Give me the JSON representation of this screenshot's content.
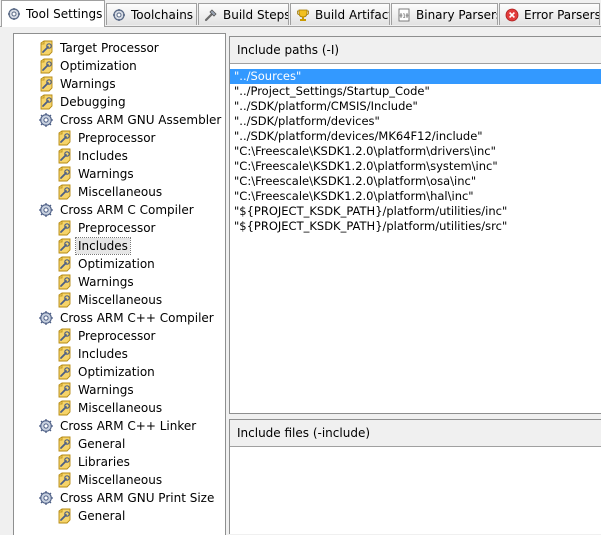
{
  "tabs": [
    {
      "label": "Tool Settings",
      "icon": "tool-settings-icon"
    },
    {
      "label": "Toolchains",
      "icon": "toolchains-icon"
    },
    {
      "label": "Build Steps",
      "icon": "build-steps-icon"
    },
    {
      "label": "Build Artifact",
      "icon": "build-artifact-icon"
    },
    {
      "label": "Binary Parsers",
      "icon": "binary-parsers-icon"
    },
    {
      "label": "Error Parsers",
      "icon": "error-parsers-icon"
    }
  ],
  "tree": {
    "items": [
      {
        "label": "Target Processor",
        "icon": "wrench-page-icon"
      },
      {
        "label": "Optimization",
        "icon": "wrench-page-icon"
      },
      {
        "label": "Warnings",
        "icon": "wrench-page-icon"
      },
      {
        "label": "Debugging",
        "icon": "wrench-page-icon"
      },
      {
        "label": "Cross ARM GNU Assembler",
        "icon": "tool-gear-icon"
      },
      {
        "label": "Preprocessor",
        "icon": "wrench-page-icon"
      },
      {
        "label": "Includes",
        "icon": "wrench-page-icon"
      },
      {
        "label": "Warnings",
        "icon": "wrench-page-icon"
      },
      {
        "label": "Miscellaneous",
        "icon": "wrench-page-icon"
      },
      {
        "label": "Cross ARM C Compiler",
        "icon": "tool-gear-icon"
      },
      {
        "label": "Preprocessor",
        "icon": "wrench-page-icon"
      },
      {
        "label": "Includes",
        "icon": "wrench-page-icon"
      },
      {
        "label": "Optimization",
        "icon": "wrench-page-icon"
      },
      {
        "label": "Warnings",
        "icon": "wrench-page-icon"
      },
      {
        "label": "Miscellaneous",
        "icon": "wrench-page-icon"
      },
      {
        "label": "Cross ARM C++ Compiler",
        "icon": "tool-gear-icon"
      },
      {
        "label": "Preprocessor",
        "icon": "wrench-page-icon"
      },
      {
        "label": "Includes",
        "icon": "wrench-page-icon"
      },
      {
        "label": "Optimization",
        "icon": "wrench-page-icon"
      },
      {
        "label": "Warnings",
        "icon": "wrench-page-icon"
      },
      {
        "label": "Miscellaneous",
        "icon": "wrench-page-icon"
      },
      {
        "label": "Cross ARM C++ Linker",
        "icon": "tool-gear-icon"
      },
      {
        "label": "General",
        "icon": "wrench-page-icon"
      },
      {
        "label": "Libraries",
        "icon": "wrench-page-icon"
      },
      {
        "label": "Miscellaneous",
        "icon": "wrench-page-icon"
      },
      {
        "label": "Cross ARM GNU Print Size",
        "icon": "tool-gear-icon"
      },
      {
        "label": "General",
        "icon": "wrench-page-icon"
      }
    ]
  },
  "include_paths": {
    "header": "Include paths (-I)",
    "items": [
      "\"../Sources\"",
      "\"../Project_Settings/Startup_Code\"",
      "\"../SDK/platform/CMSIS/Include\"",
      "\"../SDK/platform/devices\"",
      "\"../SDK/platform/devices/MK64F12/include\"",
      "\"C:\\Freescale\\KSDK1.2.0\\platform\\drivers\\inc\"",
      "\"C:\\Freescale\\KSDK1.2.0\\platform\\system\\inc\"",
      "\"C:\\Freescale\\KSDK1.2.0\\platform\\osa\\inc\"",
      "\"C:\\Freescale\\KSDK1.2.0\\platform\\hal\\inc\"",
      "\"${PROJECT_KSDK_PATH}/platform/utilities/inc\"",
      "\"${PROJECT_KSDK_PATH}/platform/utilities/src\""
    ]
  },
  "include_files": {
    "header": "Include files (-include)"
  },
  "colors": {
    "selection": "#3399ff",
    "tab_border": "#a0a0a0",
    "window_bg": "#f0f0f0"
  }
}
